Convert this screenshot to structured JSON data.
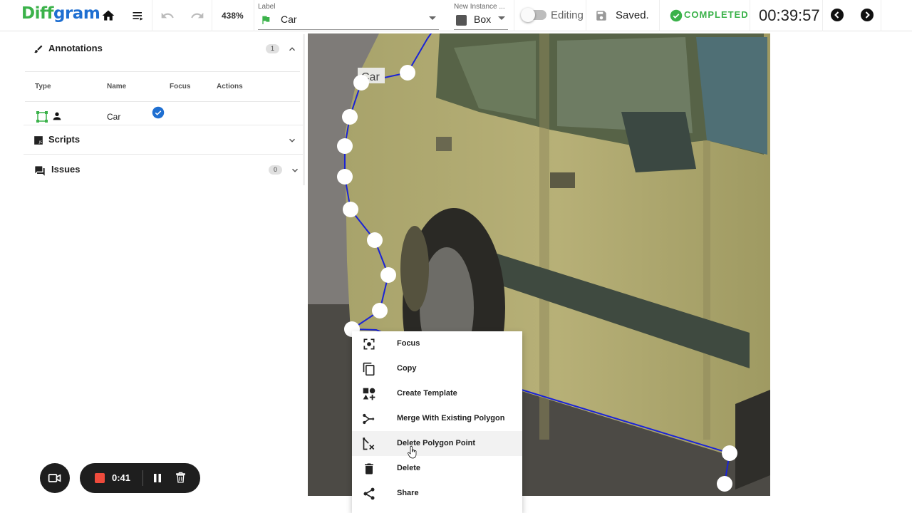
{
  "app": {
    "logo_part1": "Diff",
    "logo_part2": "gram",
    "zoom": "438%",
    "label_field": {
      "caption": "Label",
      "value": "Car",
      "flag_color": "#3bb24a"
    },
    "instance_field": {
      "caption": "New Instance ...",
      "value": "Box"
    },
    "editing_label": "Editing",
    "save_status": "Saved.",
    "task_status": "COMPLETED",
    "timer": "00:39:57",
    "brand_green": "#3bb24a",
    "brand_blue": "#1f6fd1"
  },
  "sidebar": {
    "annotations": {
      "title": "Annotations",
      "count": "1",
      "columns": [
        "Type",
        "Name",
        "Focus",
        "Actions"
      ],
      "rows": [
        {
          "type_icon": "polygon-icon",
          "owner_icon": "person-icon",
          "name": "Car",
          "focused": true
        }
      ]
    },
    "scripts": {
      "title": "Scripts"
    },
    "issues": {
      "title": "Issues",
      "count": "0"
    }
  },
  "canvas": {
    "instance_label": "Car",
    "polygon_color": "#1a23d6"
  },
  "context_menu": {
    "items": [
      {
        "label": "Focus",
        "icon": "focus-icon"
      },
      {
        "label": "Copy",
        "icon": "copy-icon"
      },
      {
        "label": "Create Template",
        "icon": "shapes-plus-icon"
      },
      {
        "label": "Merge With Existing Polygon",
        "icon": "merge-icon"
      },
      {
        "label": "Delete Polygon Point",
        "icon": "delete-point-icon"
      },
      {
        "label": "Delete",
        "icon": "trash-icon"
      },
      {
        "label": "Share",
        "icon": "share-icon"
      }
    ],
    "highlighted_index": 4
  },
  "recorder": {
    "elapsed": "0:41",
    "stop_color": "#ef4b3c"
  }
}
